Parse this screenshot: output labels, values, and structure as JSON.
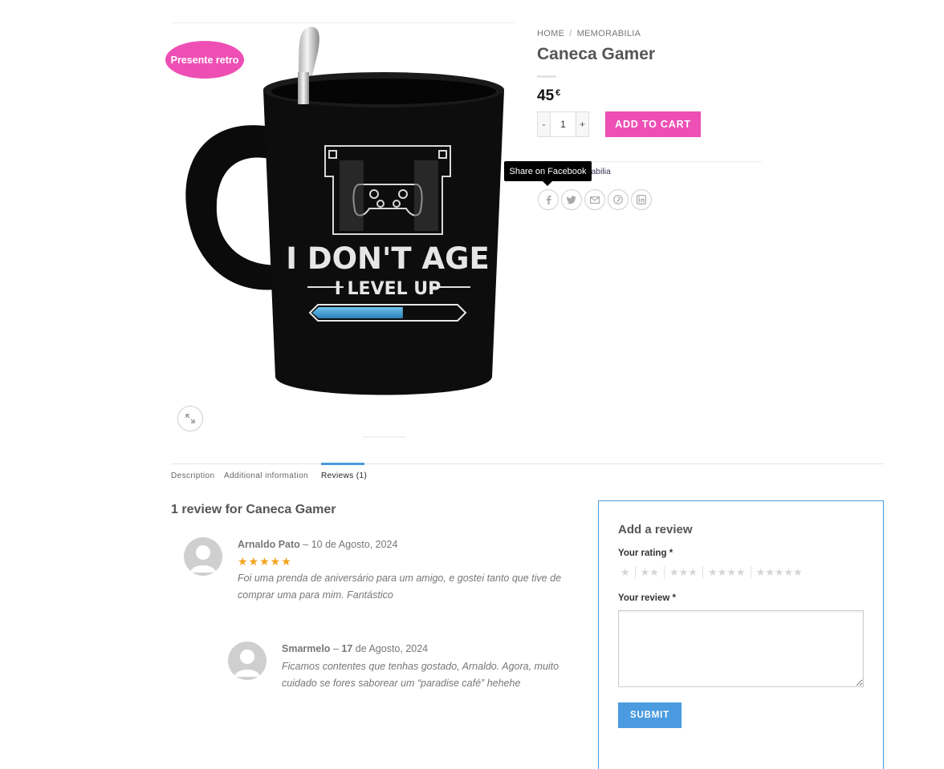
{
  "badge": {
    "label": "Presente retro"
  },
  "mug_print": {
    "line1": "I DON'T AGE",
    "line2": "I LEVEL UP",
    "level_progress": 0.6
  },
  "breadcrumb": {
    "home": "HOME",
    "separator": "/",
    "category": "MEMORABILIA"
  },
  "product": {
    "title": "Caneca Gamer",
    "price": "45",
    "currency": "€"
  },
  "cart": {
    "minus": "-",
    "plus": "+",
    "quantity": "1",
    "add_label": "ADD TO CART"
  },
  "meta": {
    "category_visible": "orabilia"
  },
  "tooltip": {
    "text": "Share on Facebook"
  },
  "share_icons": [
    "facebook-icon",
    "twitter-icon",
    "email-icon",
    "pinterest-icon",
    "linkedin-icon"
  ],
  "tabs": [
    {
      "label": "Description"
    },
    {
      "label": "Additional information"
    },
    {
      "label": "Reviews (1)"
    }
  ],
  "reviews": {
    "heading": "1 review for Caneca Gamer",
    "items": [
      {
        "author": "Arnaldo Pato",
        "dash": "–",
        "date": "10 de Agosto, 2024",
        "rating": 5,
        "stars": "★★★★★",
        "text": "Foi uma prenda de aniversário para um amigo, e gostei tanto que tive de comprar uma para mim. Fantástico"
      },
      {
        "author": "Smarmelo",
        "dash": "–",
        "date_day": "17",
        "date_rest": "de Agosto, 2024",
        "text": "Ficamos contentes que tenhas gostado, Arnaldo. Agora, muito cuidado se fores saborear um “paradise café” hehehe"
      }
    ]
  },
  "add_review": {
    "title": "Add a review",
    "rating_label": "Your rating",
    "review_label": "Your review",
    "required": "*",
    "rating_options": [
      "★",
      "★★",
      "★★★",
      "★★★★",
      "★★★★★"
    ],
    "submit": "SUBMIT"
  },
  "colors": {
    "pink_accent": "#ee4fb4",
    "blue_accent": "#4a9be0",
    "star": "#f2a31b"
  }
}
